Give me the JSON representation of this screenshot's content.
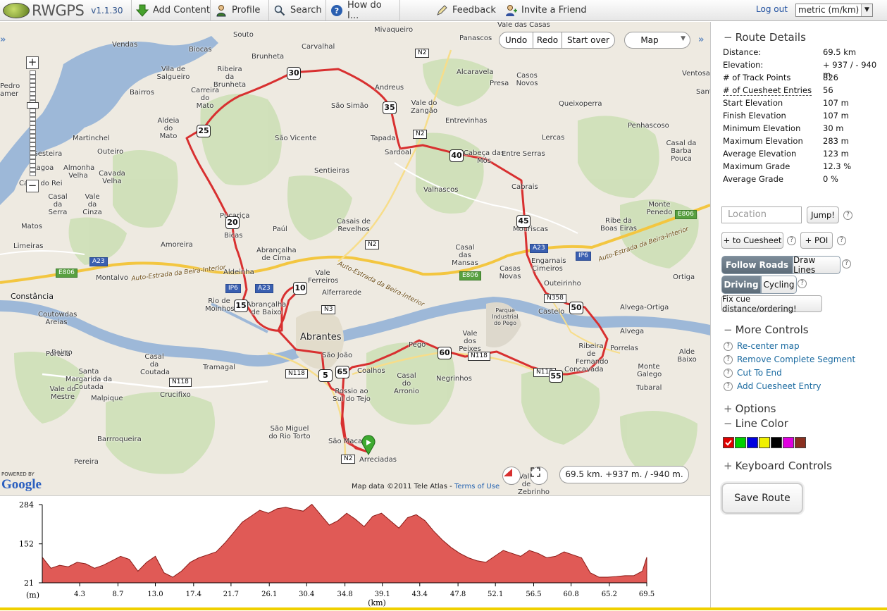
{
  "app": {
    "name": "RWGPS",
    "version": "v1.1.30"
  },
  "nav": {
    "add_content": "Add Content",
    "profile": "Profile",
    "search": "Search",
    "how_do_i": "How do I...",
    "feedback": "Feedback",
    "invite": "Invite a Friend",
    "logout": "Log out",
    "units": "metric (m/km)"
  },
  "map": {
    "undo": "Undo",
    "redo": "Redo",
    "start_over": "Start over",
    "map_type": "Map",
    "distance_summary": "69.5 km. +937 m. / -940 m.",
    "map_data": "Map data ©2011  Tele Atlas -",
    "terms": "Terms of Use",
    "powered_by": "POWERED BY",
    "google": "Google",
    "places": [
      {
        "name": "Souto"
      },
      {
        "name": "Mivaqueiro"
      },
      {
        "name": "Panascos"
      },
      {
        "name": "Vendas"
      },
      {
        "name": "Biocas"
      },
      {
        "name": "Carvalhal"
      },
      {
        "name": "Vila de Salgueiro"
      },
      {
        "name": "Brunheta"
      },
      {
        "name": "Ribeira da Brunheta"
      },
      {
        "name": "Andreus"
      },
      {
        "name": "Alcaravela"
      },
      {
        "name": "Casos Novos"
      },
      {
        "name": "Bairros"
      },
      {
        "name": "Carreira do Mato"
      },
      {
        "name": "São Simão"
      },
      {
        "name": "Vale do Zangão"
      },
      {
        "name": "Presa"
      },
      {
        "name": "Queixoperra"
      },
      {
        "name": "Aldeia do Mato"
      },
      {
        "name": "São Vicente"
      },
      {
        "name": "Entrevinhas"
      },
      {
        "name": "Penhascoso"
      },
      {
        "name": "Martinchel"
      },
      {
        "name": "Tapada"
      },
      {
        "name": "Lercas"
      },
      {
        "name": "Outeiro"
      },
      {
        "name": "Sardoal"
      },
      {
        "name": "Cabeça das Mós"
      },
      {
        "name": "Entre Serras"
      },
      {
        "name": "Casal da Barba Pouca"
      },
      {
        "name": "Almonha Velha"
      },
      {
        "name": "Cavada Velha"
      },
      {
        "name": "Sentieiras"
      },
      {
        "name": "Casal do Rei"
      },
      {
        "name": "Valhascos"
      },
      {
        "name": "Cabrais"
      },
      {
        "name": "Casal da Serra"
      },
      {
        "name": "Vale da Cinza"
      },
      {
        "name": "Monte Penedo"
      },
      {
        "name": "Pucariça"
      },
      {
        "name": "Casais de Revelhos"
      },
      {
        "name": "Ribe da Boas Eiras"
      },
      {
        "name": "Matos"
      },
      {
        "name": "Bicas"
      },
      {
        "name": "Paúl"
      },
      {
        "name": "Mouriscas"
      },
      {
        "name": "Limeiras"
      },
      {
        "name": "Abrançalha de Cima"
      },
      {
        "name": "Casal das Mansas"
      },
      {
        "name": "Amoreira"
      },
      {
        "name": "Engarnais Cimeiros"
      },
      {
        "name": "Aldeinha"
      },
      {
        "name": "Vale Ferreiros"
      },
      {
        "name": "Montalvo"
      },
      {
        "name": "Casas Novas"
      },
      {
        "name": "Ortiga"
      },
      {
        "name": "Outeirinho"
      },
      {
        "name": "Constância"
      },
      {
        "name": "Rio de Moinhos"
      },
      {
        "name": "Abrançalha de Baixo"
      },
      {
        "name": "Alferrarede"
      },
      {
        "name": "Castelo"
      },
      {
        "name": "Alvega-Ortiga"
      },
      {
        "name": "Parque Industrial do Pego"
      },
      {
        "name": "Coutowdas Areias"
      },
      {
        "name": "Alvega"
      },
      {
        "name": "Abrantes"
      },
      {
        "name": "Vale dos Peixes"
      },
      {
        "name": "Pego"
      },
      {
        "name": "Ribeira de Fernando"
      },
      {
        "name": "Porrelas"
      },
      {
        "name": "Alde Baixo"
      },
      {
        "name": "Bairro"
      },
      {
        "name": "Tramagal"
      },
      {
        "name": "Casal da Coutada"
      },
      {
        "name": "São João"
      },
      {
        "name": "Coalhos"
      },
      {
        "name": "Concavada"
      },
      {
        "name": "Monte Galego"
      },
      {
        "name": "Portela"
      },
      {
        "name": "Santa Margarida da Coutada"
      },
      {
        "name": "Casal do Arronio"
      },
      {
        "name": "Negrinhos"
      },
      {
        "name": "Vale do Mestre"
      },
      {
        "name": "Crucifixo"
      },
      {
        "name": "Rossio ao Sul do Tejo"
      },
      {
        "name": "Tubaral"
      },
      {
        "name": "Malpique"
      },
      {
        "name": "São Miguel do Rio Torto"
      },
      {
        "name": "Barrroqueira"
      },
      {
        "name": "São Macar"
      },
      {
        "name": "Pereira"
      },
      {
        "name": "Arreciadas"
      },
      {
        "name": "Vale de Zebrinho"
      },
      {
        "name": "Vale das Casas"
      },
      {
        "name": "Ventosa"
      },
      {
        "name": "Gesteira"
      },
      {
        "name": "Lagoa"
      },
      {
        "name": "Pedro amer"
      },
      {
        "name": "Sant"
      },
      {
        "name": "Sao Jose"
      }
    ],
    "roads": {
      "auto_estrada_1": "Auto-Estrada da Beira-Interior",
      "auto_estrada_2": "Auto-Estrada da Beira-Interior",
      "auto_estrada_3": "Auto-Estrada da Beira-Interior"
    },
    "shields": [
      "N2",
      "N2",
      "N2",
      "N3",
      "N118",
      "N118",
      "N118",
      "N118",
      "N358",
      "N2",
      "A23",
      "A23",
      "A23",
      "IP6",
      "IP6",
      "E806",
      "E806",
      "E806"
    ],
    "km_markers": [
      "5",
      "10",
      "15",
      "20",
      "25",
      "30",
      "35",
      "40",
      "45",
      "50",
      "55",
      "60",
      "65"
    ]
  },
  "elevation": {
    "y_unit": "(m)",
    "x_unit": "(km)",
    "colors": {
      "fill": "#e05a56",
      "line": "#8a1a16"
    }
  },
  "chart_data": {
    "type": "area",
    "title": "",
    "xlabel": "(km)",
    "ylabel": "(m)",
    "yticks": [
      21,
      152,
      284
    ],
    "ylim": [
      21,
      284
    ],
    "xlim": [
      0,
      69.5
    ],
    "xticks": [
      "4.3",
      "8.7",
      "13.0",
      "17.4",
      "21.7",
      "26.1",
      "30.4",
      "34.8",
      "39.1",
      "43.4",
      "47.8",
      "52.1",
      "56.5",
      "60.8",
      "65.2",
      "69.5"
    ],
    "x": [
      0,
      1,
      2,
      3,
      4,
      5,
      6,
      7,
      8,
      9,
      10,
      11,
      12,
      13,
      14,
      15,
      16,
      17,
      18,
      19,
      20,
      21,
      22,
      23,
      24,
      25,
      26,
      27,
      28,
      29,
      30,
      31,
      32,
      33,
      34,
      35,
      36,
      37,
      38,
      39,
      40,
      41,
      42,
      43,
      44,
      45,
      46,
      47,
      48,
      49,
      50,
      51,
      52,
      53,
      54,
      55,
      56,
      57,
      58,
      59,
      60,
      61,
      62,
      63,
      64,
      65,
      66,
      67,
      68,
      69,
      69.5
    ],
    "y": [
      107,
      70,
      80,
      75,
      90,
      85,
      70,
      80,
      95,
      110,
      100,
      60,
      90,
      110,
      55,
      40,
      60,
      90,
      105,
      115,
      125,
      155,
      190,
      225,
      245,
      265,
      255,
      270,
      275,
      268,
      262,
      285,
      250,
      215,
      230,
      255,
      235,
      210,
      245,
      255,
      230,
      205,
      240,
      250,
      230,
      195,
      165,
      140,
      120,
      105,
      95,
      90,
      110,
      130,
      120,
      110,
      130,
      120,
      105,
      110,
      125,
      115,
      105,
      55,
      40,
      40,
      42,
      45,
      45,
      60,
      107
    ]
  },
  "panel": {
    "route_details": "Route Details",
    "details": [
      {
        "k": "Distance:",
        "v": "69.5 km"
      },
      {
        "k": "Elevation:",
        "v": "+ 937 / - 940 m"
      },
      {
        "k": "# of Track Points",
        "v": "826"
      },
      {
        "k": "# of Cuesheet Entries",
        "v": "56"
      },
      {
        "k": "Start Elevation",
        "v": "107 m"
      },
      {
        "k": "Finish Elevation",
        "v": "107 m"
      },
      {
        "k": "Minimum Elevation",
        "v": "30 m"
      },
      {
        "k": "Maximum Elevation",
        "v": "283 m"
      },
      {
        "k": "Average Elevation",
        "v": "123 m"
      },
      {
        "k": "Maximum Grade",
        "v": "12.3 %"
      },
      {
        "k": "Average Grade",
        "v": "0 %"
      }
    ],
    "location_placeholder": "Location",
    "jump": "Jump!",
    "to_cuesheet": "+ to Cuesheet",
    "poi": "+ POI",
    "follow_roads": "Follow Roads",
    "draw_lines": "Draw Lines",
    "driving": "Driving",
    "cycling": "Cycling",
    "fix_cue": "Fix cue distance/ordering!",
    "more_controls": "More Controls",
    "links": [
      "Re-center map",
      "Remove Complete Segment",
      "Cut To End",
      "Add Cuesheet Entry"
    ],
    "options": "Options",
    "line_color": "Line Color",
    "colors": [
      "#e00000",
      "#00d000",
      "#0000e0",
      "#f0f000",
      "#000000",
      "#e000e0",
      "#8a3020"
    ],
    "keyboard_controls": "Keyboard Controls",
    "save_route": "Save Route"
  }
}
